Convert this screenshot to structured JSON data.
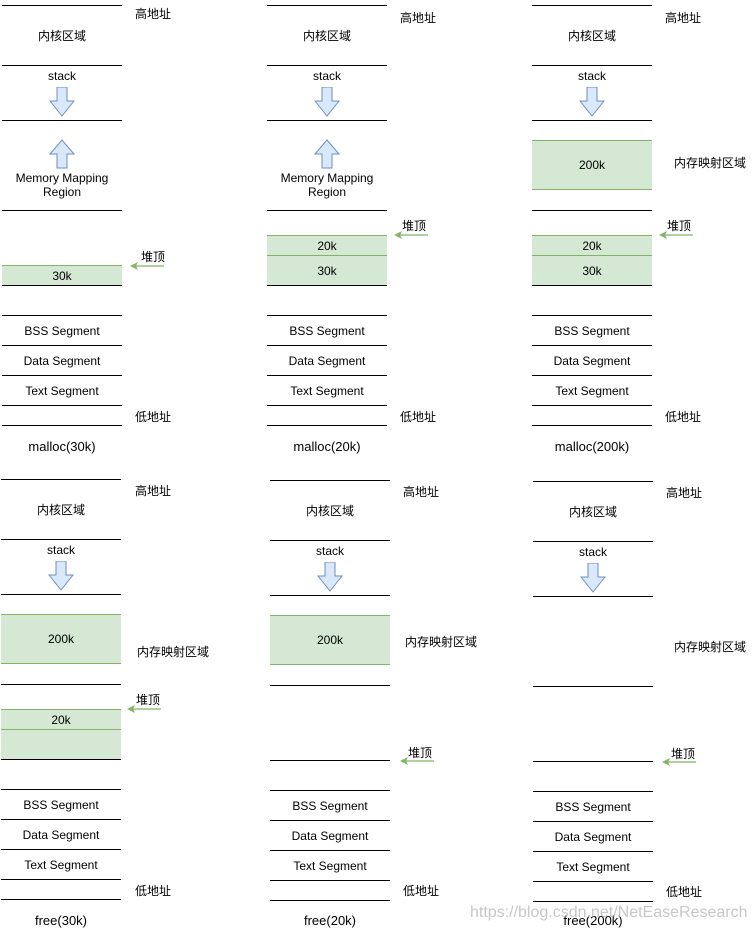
{
  "colors": {
    "block_fill": "#d5e8d4",
    "block_stroke": "#82b366",
    "arrow_fill": "#dae8fc",
    "arrow_stroke": "#6c8ebf",
    "heap_arrow": "#82b366"
  },
  "labels": {
    "high_address": "高地址",
    "low_address": "低地址",
    "kernel": "内核区域",
    "stack": "stack",
    "mmr": "Memory Mapping Region",
    "mmr_line1": "Memory Mapping",
    "mmr_line2": "Region",
    "mmap_area": "内存映射区域",
    "heap_top": "堆顶",
    "bss": "BSS Segment",
    "data": "Data Segment",
    "text": "Text Segment"
  },
  "panels": [
    {
      "caption": "malloc(30k)",
      "blocks": [
        {
          "label": "30k"
        }
      ]
    },
    {
      "caption": "malloc(20k)",
      "blocks": [
        {
          "label": "20k"
        },
        {
          "label": "30k"
        }
      ]
    },
    {
      "caption": "malloc(200k)",
      "blocks": [
        {
          "label": "200k",
          "region": "mmap"
        },
        {
          "label": "20k"
        },
        {
          "label": "30k"
        }
      ]
    },
    {
      "caption": "free(30k)",
      "blocks": [
        {
          "label": "200k",
          "region": "mmap"
        },
        {
          "label": "20k"
        },
        {
          "label": "",
          "state": "freed-30k"
        }
      ]
    },
    {
      "caption": "free(20k)",
      "blocks": [
        {
          "label": "200k",
          "region": "mmap"
        }
      ]
    },
    {
      "caption": "free(200k)",
      "blocks": []
    }
  ],
  "watermark": "https://blog.csdn.net/NetEaseResearch"
}
